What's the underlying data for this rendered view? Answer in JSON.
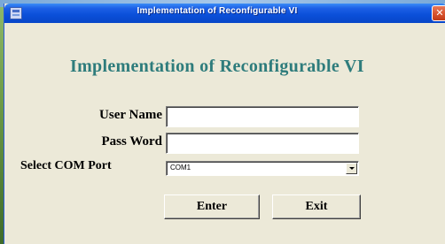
{
  "window": {
    "title": "Implementation of Reconfigurable VI",
    "close_glyph": "✕"
  },
  "form": {
    "heading": "Implementation of Reconfigurable VI",
    "user_name_label": "User Name",
    "user_name_value": "",
    "password_label": "Pass Word",
    "password_value": "",
    "com_port_label": "Select COM Port",
    "com_port_selected": "COM1"
  },
  "buttons": {
    "enter_label": "Enter",
    "exit_label": "Exit"
  },
  "icons": {
    "app": "app-window-icon",
    "close": "close-icon",
    "dropdown": "chevron-down-icon"
  },
  "colors": {
    "titlebar": "#0a4fd8",
    "heading": "#2e7c7c",
    "window_bg": "#ece9d8",
    "close_button": "#d6502a"
  }
}
